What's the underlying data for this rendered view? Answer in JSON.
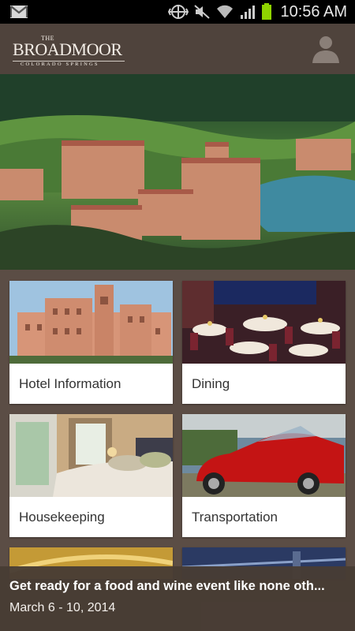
{
  "status_bar": {
    "time": "10:56 AM",
    "icons": [
      "gmail-icon",
      "signal-strength-icon",
      "mute-icon",
      "wifi-icon",
      "cell-signal-icon",
      "battery-icon"
    ]
  },
  "header": {
    "logo_the": "THE",
    "logo_name": "BROADMOOR",
    "logo_sub": "COLORADO SPRINGS",
    "profile_icon": "user-silhouette-icon"
  },
  "tiles": [
    {
      "label": "Hotel Information"
    },
    {
      "label": "Dining"
    },
    {
      "label": "Housekeeping"
    },
    {
      "label": "Transportation"
    }
  ],
  "banner": {
    "title": "Get ready for a food and wine event like none oth...",
    "date": "March 6 - 10, 2014"
  },
  "colors": {
    "header_bg": "#4f433c",
    "body_bg": "#5b4d45",
    "banner_bg": "#483c34"
  }
}
